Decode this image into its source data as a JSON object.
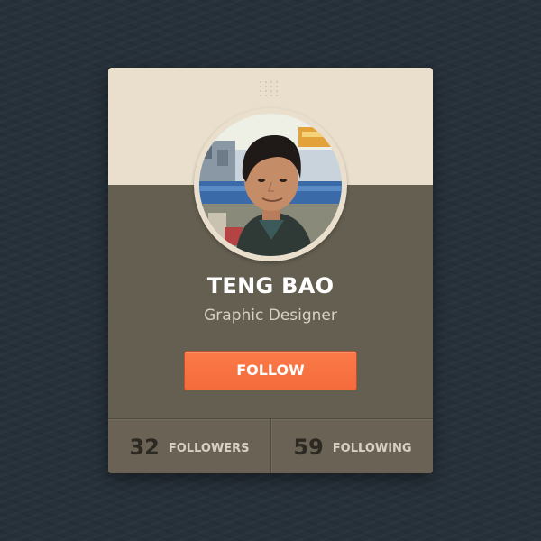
{
  "profile": {
    "name": "TENG BAO",
    "title": "Graphic Designer"
  },
  "follow_button": {
    "label": "FOLLOW"
  },
  "stats": {
    "followers": {
      "count": "32",
      "label": "FOLLOWERS"
    },
    "following": {
      "count": "59",
      "label": "FOLLOWING"
    }
  },
  "colors": {
    "page_background": "#27313a",
    "card_header": "#e9dfcc",
    "card_body": "#655f51",
    "accent_button": "#f97545",
    "stat_count": "#2c2922",
    "secondary_text": "#d8d1c2"
  },
  "icons": {
    "grip": "dot-grid-grip-icon",
    "avatar": "profile-photo"
  }
}
